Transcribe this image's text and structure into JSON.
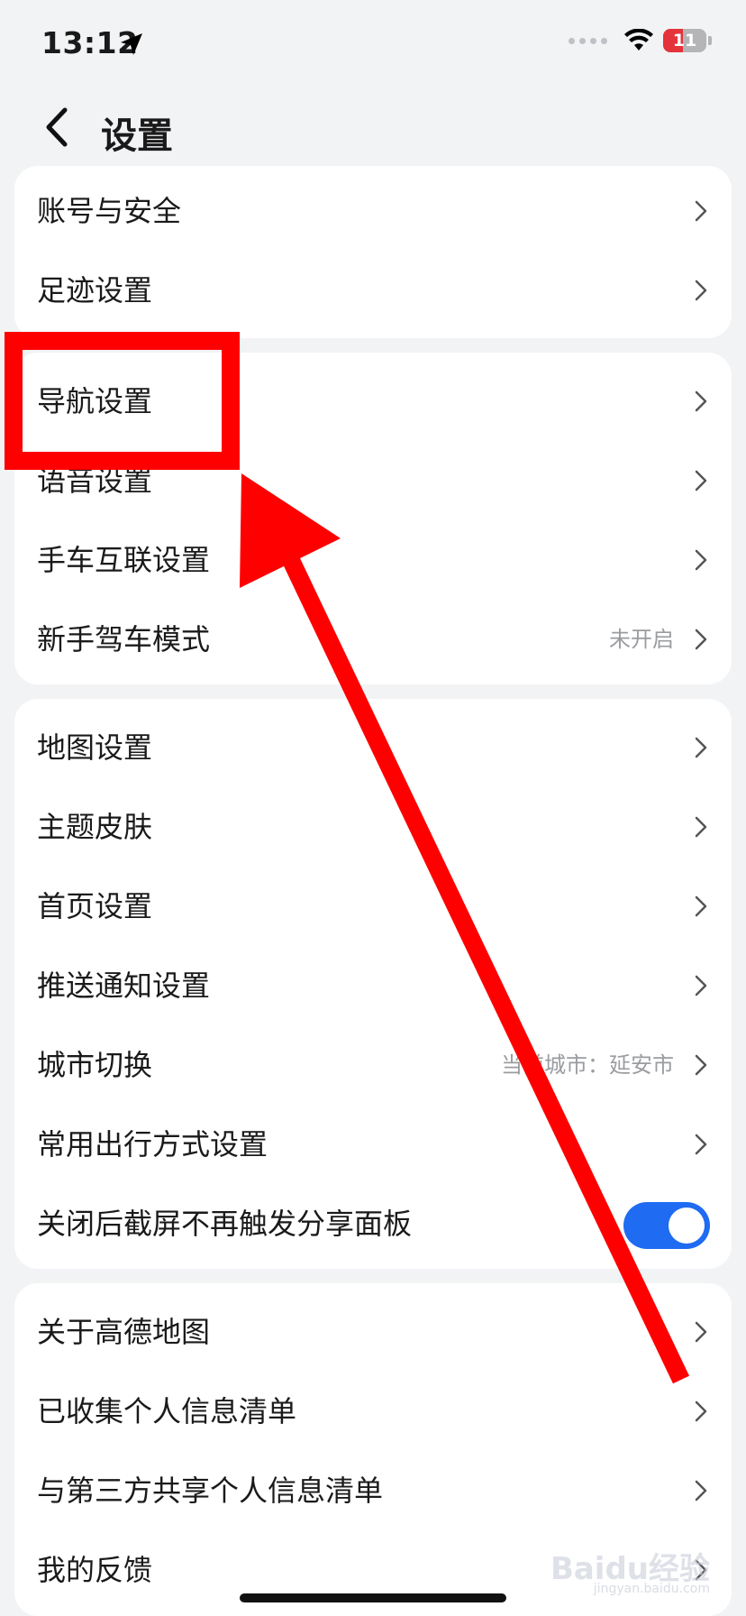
{
  "status_bar": {
    "time": "13:12",
    "battery": "11"
  },
  "header": {
    "title": "设置"
  },
  "groups": [
    {
      "items": [
        {
          "label": "账号与安全"
        },
        {
          "label": "足迹设置"
        }
      ]
    },
    {
      "items": [
        {
          "label": "导航设置"
        },
        {
          "label": "语音设置"
        },
        {
          "label": "手车互联设置"
        },
        {
          "label": "新手驾车模式",
          "value": "未开启"
        }
      ]
    },
    {
      "items": [
        {
          "label": "地图设置"
        },
        {
          "label": "主题皮肤"
        },
        {
          "label": "首页设置"
        },
        {
          "label": "推送通知设置"
        },
        {
          "label": "城市切换",
          "value": "当前城市：延安市"
        },
        {
          "label": "常用出行方式设置"
        },
        {
          "label": "关闭后截屏不再触发分享面板",
          "toggle": true
        }
      ]
    },
    {
      "items": [
        {
          "label": "关于高德地图"
        },
        {
          "label": "已收集个人信息清单"
        },
        {
          "label": "与第三方共享个人信息清单"
        },
        {
          "label": "我的反馈"
        }
      ]
    }
  ],
  "annotation": {
    "color": "#ff0000",
    "highlighted_item": "导航设置"
  },
  "watermark": {
    "text": "Baidu经验",
    "sub": "jingyan.baidu.com"
  }
}
